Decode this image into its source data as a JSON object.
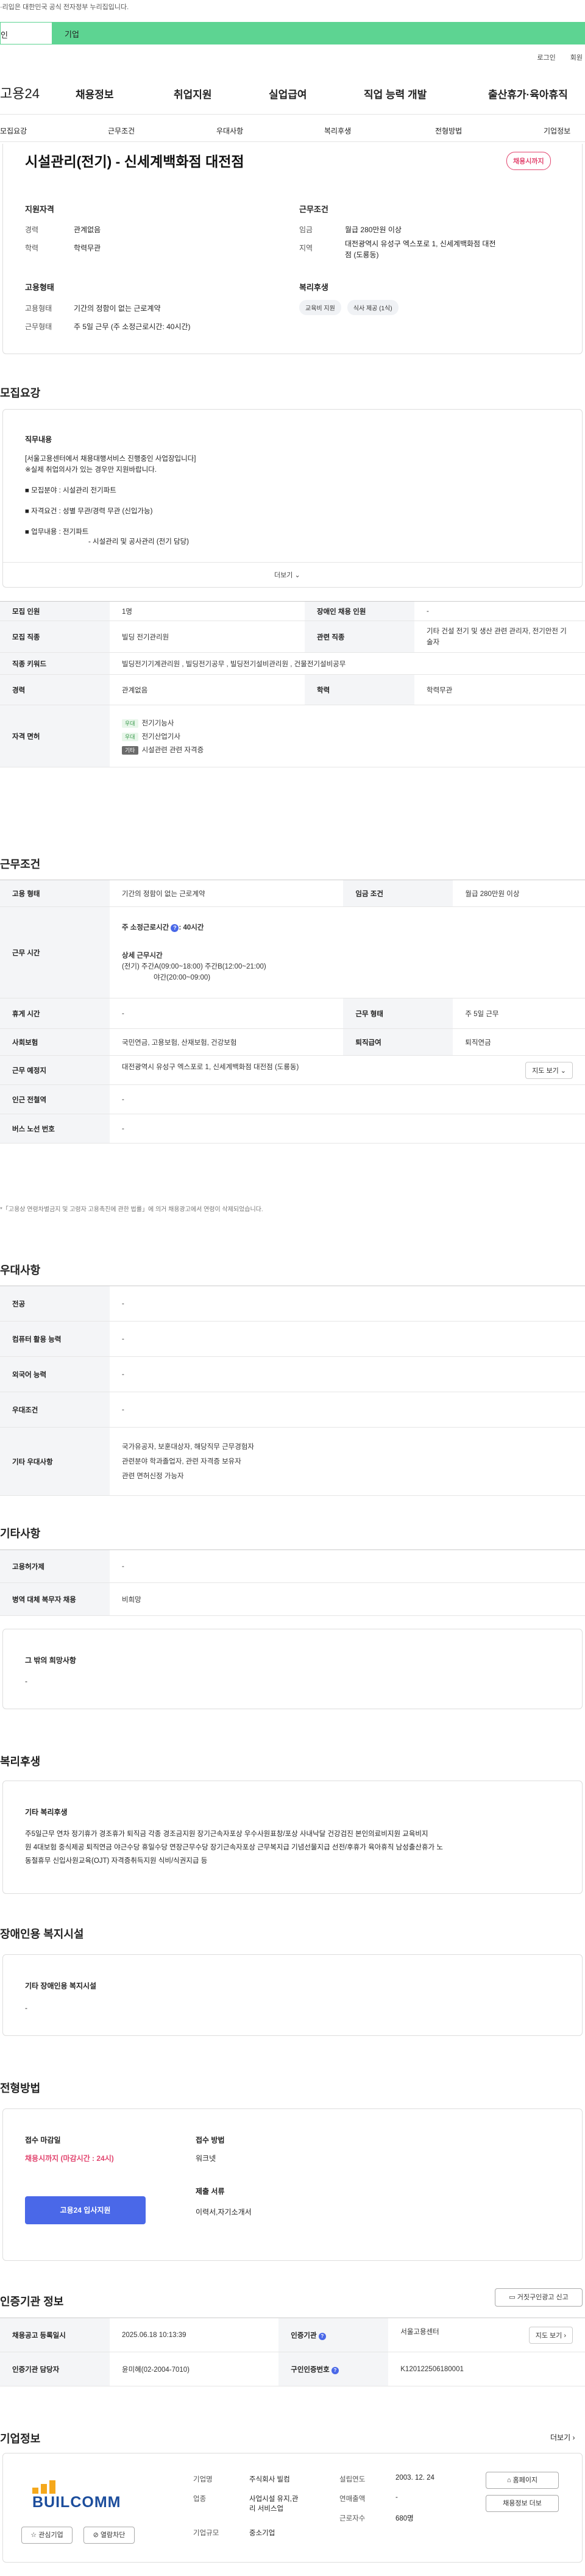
{
  "notice": "·리입은 대한민국 공식 전자정부 누리집입니다.",
  "segments": [
    "인",
    "기업"
  ],
  "util": [
    "로그인",
    "회원"
  ],
  "logo": "고용24",
  "gnb": [
    "채용정보",
    "취업지원",
    "실업급여",
    "직업 능력 개발",
    "출산휴가·육아휴직"
  ],
  "lnb": [
    "모집요강",
    "근무조건",
    "우대사항",
    "복리후생",
    "전형방법",
    "기업정보"
  ],
  "job": {
    "title": "시설관리(전기) - 신세계백화점 대전점",
    "status": "채용시까지",
    "qual_title": "지원자격",
    "career_k": "경력",
    "career_v": "관계없음",
    "edu_k": "학력",
    "edu_v": "학력무관",
    "emp_title": "고용형태",
    "emptype_k": "고용형태",
    "emptype_v": "기간의 정함이 없는 근로계약",
    "work_k": "근무형태",
    "work_v": "주 5일 근무 (주 소정근로시간: 40시간)",
    "cond_title": "근무조건",
    "wage_k": "임금",
    "wage_v": "월급 280만원 이상",
    "loc_k": "지역",
    "loc_v": "대전광역시 유성구 엑스포로 1, 신세계백화점 대전점 (도룡동)",
    "welfare_title": "복리후생",
    "welfare": [
      "교육비 지원",
      "식사 제공 (1식)"
    ]
  },
  "recruit": {
    "title": "모집요강",
    "duty_h": "직무내용",
    "lines": [
      "[서울고용센터에서 채용대행서비스 진행중인 사업장입니다]",
      "※실제 취업의사가 있는 경우만 지원바랍니다."
    ],
    "b1": "■ 모집분야 : 시설관리 전기파트",
    "b2": "■ 자격요건 : 성별 무관/경력 무관 (신입가능)",
    "b3": "■ 업무내용 :  전기파트",
    "b3b": "- 시설관리 및 공사관리 (전기 담당)",
    "more": "더보기",
    "rows": {
      "cnt_k": "모집 인원",
      "cnt_v": "1명",
      "dis_k": "장애인 채용 인원",
      "dis_v": "-",
      "job_k": "모집 직종",
      "job_v": "빌딩 전기관리원",
      "rel_k": "관련 직종",
      "rel_v": "기타 건설 전기 및 생산 관련 관리자, 전기안전 기술자",
      "kw_k": "직종 키워드",
      "kw_v": "빌딩전기기계관리원 , 빌딩전기공무 , 빌딩전기설비관리원 , 건물전기설비공무",
      "car_k": "경력",
      "car_v": "관계없음",
      "edu_k": "학력",
      "edu_v": "학력무관",
      "lic_k": "자격 면허",
      "lic": [
        {
          "tag": "우대",
          "name": "전기기능사"
        },
        {
          "tag": "우대",
          "name": "전기산업기사"
        },
        {
          "tag": "기타",
          "name": "시설관련 관련 자격증"
        }
      ]
    }
  },
  "cond": {
    "title": "근무조건",
    "r1k": "고용 형태",
    "r1v": "기간의 정함이 없는 근로계약",
    "r1k2": "임금 조건",
    "r1v2": "월급 280만원 이상",
    "r2k": "근무 시간",
    "weekly": "주 소정근로시간",
    "weekly_v": "40시간",
    "detail_h": "상세 근무시간",
    "detail1": "(전기) 주간A(09:00~18:00) 주간B(12:00~21:00)",
    "detail2": "야간(20:00~09:00)",
    "r3k": "휴게 시간",
    "r3v": "-",
    "r3k2": "근무 형태",
    "r3v2": "주 5일 근무",
    "r4k": "사회보험",
    "r4v": "국민연금, 고용보험, 산재보험, 건강보험",
    "r4k2": "퇴직급여",
    "r4v2": "퇴직연금",
    "r5k": "근무 예정지",
    "r5v": "대전광역시 유성구 엑스포로 1, 신세계백화점 대전점 (도룡동)",
    "map": "지도 보기",
    "r6k": "인근 전철역",
    "r6v": "-",
    "r7k": "버스 노선 번호",
    "r7v": "-",
    "note": "*「고용상 연령차별금지 및 고령자 고용촉진에 관한 법률」에 의거 채용광고에서 연령이 삭제되었습니다."
  },
  "pref": {
    "title": "우대사항",
    "rows": [
      {
        "k": "전공",
        "v": "-"
      },
      {
        "k": "컴퓨터 활용 능력",
        "v": "-"
      },
      {
        "k": "외국어 능력",
        "v": "-"
      },
      {
        "k": "우대조건",
        "v": "-"
      }
    ],
    "etc_k": "기타 우대사항",
    "etc": [
      "국가유공자, 보훈대상자, 해당직무 근무경험자",
      "관련분야 학과졸업자, 관련 자격증 보유자",
      "관련 면허신정 가능자"
    ]
  },
  "other": {
    "title": "기타사항",
    "r1k": "고용허가제",
    "r1v": "-",
    "r2k": "병역 대체 복무자 채용",
    "r2v": "비희망",
    "hope_h": "그 밖의 희망사항",
    "hope_v": "-"
  },
  "welfare": {
    "title": "복리후생",
    "etc_h": "기타 복리후생",
    "text1": "주5일근무 연차 정기휴가 경조휴가 퇴직금 각종 경조금지원 장기근속자포상 우수사원표창/포상 사내낙달 건강검진 본인의료비지원 교육비지",
    "text2": "원 4대보험 중식제공 퇴직연금 야근수당 휴일수당 연장근무수당 장기근속자포상 근무복지급 기념선물지급 선전/후휴가 육아휴직 남성출산휴가 노",
    "text3": "동절휴무 신입사원교육(OJT) 자격증취득지원 식비/식권지급 등"
  },
  "disab": {
    "title": "장애인용 복지시설",
    "h": "기타 장애인용 복지시설",
    "v": "-"
  },
  "proc": {
    "title": "전형방법",
    "dl_h": "접수 마감일",
    "dl_v": "채용시까지 (마감시간 : 24시)",
    "m_h": "접수 방법",
    "m_v": "워크넷",
    "doc_h": "제출 서류",
    "doc_v": "이력서,자기소개서",
    "apply": "고용24 입사지원"
  },
  "cert": {
    "title": "인증기관 정보",
    "report": "거짓구인광고 신고",
    "r1k": "채용공고 등록일시",
    "r1v": "2025.06.18 10:13:39",
    "r1k2": "인증기관",
    "r1v2": "서울고용센터",
    "map": "지도 보기",
    "r2k": "인증기관 담당자",
    "r2v": "윤미혜(02-2004-7010)",
    "r2k2": "구인인증번호",
    "r2v2": "K120122506180001"
  },
  "company": {
    "title": "기업정보",
    "more": "더보기",
    "logo": "BUILCOMM",
    "f1k": "기업명",
    "f1v": "주식회사 빌컴",
    "f2k": "업종",
    "f2v1": "사업시설 유지,관",
    "f2v2": "리 서비스업",
    "f3k": "기업규모",
    "f3v": "중소기업",
    "g1k": "설립연도",
    "g1v": "2003. 12. 24",
    "g2k": "연매출액",
    "g2v": "-",
    "g3k": "근로자수",
    "g3v": "680명",
    "home": "홈페이지",
    "fav": "관심기업",
    "block": "열람차단",
    "jobs": "채용정보 더보"
  }
}
